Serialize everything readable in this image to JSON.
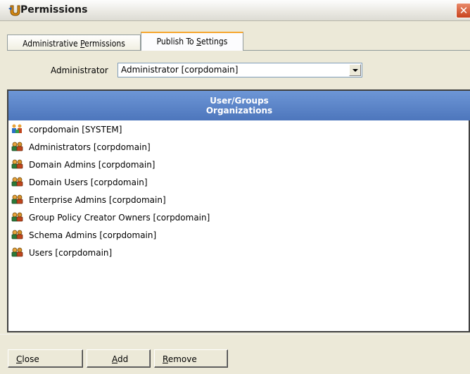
{
  "window": {
    "title": "Permissions",
    "close_glyph": "✕",
    "icon": "permissions-app-icon"
  },
  "tabs": [
    {
      "label": "Administrative Permissions",
      "selected": false
    },
    {
      "label": "Publish To Settings",
      "selected": true
    }
  ],
  "administrator": {
    "label": "Administrator",
    "selected_value": "Administrator [corpdomain]"
  },
  "list": {
    "header_line1": "User/Groups",
    "header_line2": "Organizations",
    "items": [
      {
        "label": "corpdomain [SYSTEM]",
        "icon": "organization-icon"
      },
      {
        "label": "Administrators [corpdomain]",
        "icon": "user-group-icon"
      },
      {
        "label": "Domain Admins [corpdomain]",
        "icon": "user-group-icon"
      },
      {
        "label": "Domain Users [corpdomain]",
        "icon": "user-group-icon"
      },
      {
        "label": "Enterprise Admins [corpdomain]",
        "icon": "user-group-icon"
      },
      {
        "label": "Group Policy Creator Owners [corpdomain]",
        "icon": "user-group-icon"
      },
      {
        "label": "Schema Admins [corpdomain]",
        "icon": "user-group-icon"
      },
      {
        "label": "Users [corpdomain]",
        "icon": "user-group-icon"
      }
    ]
  },
  "buttons": {
    "close": "Close",
    "add": "Add",
    "remove": "Remove"
  },
  "colors": {
    "header_blue": "#5a82c6",
    "tab_highlight": "#f6a62f",
    "close_red": "#c8421d"
  }
}
